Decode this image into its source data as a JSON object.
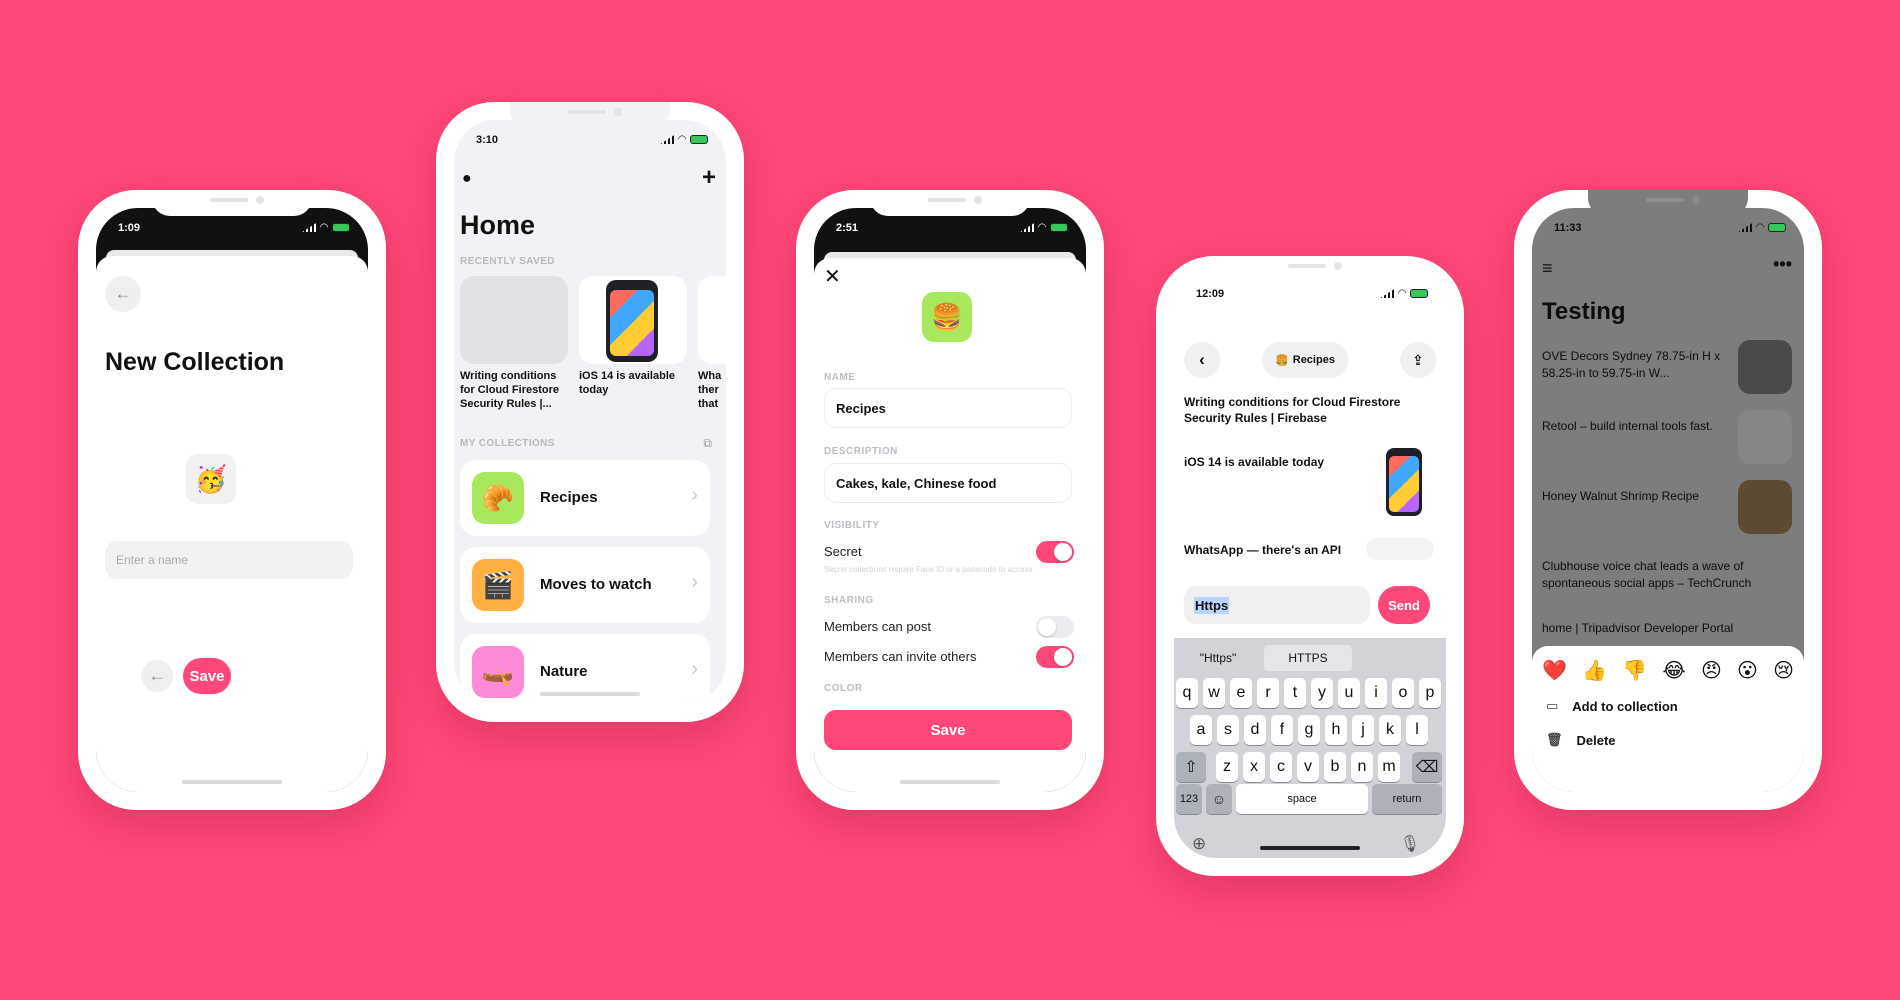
{
  "colors": {
    "accent": "#ff4778",
    "background": "#ff4778"
  },
  "phone1": {
    "time": "1:09",
    "title": "New Collection",
    "emoji": "🥳",
    "name_placeholder": "Enter a name",
    "save_label": "Save"
  },
  "phone2": {
    "time": "3:10",
    "title": "Home",
    "recently_saved_label": "RECENTLY SAVED",
    "recent": [
      {
        "text": "Writing conditions for Cloud Firestore Security Rules  |..."
      },
      {
        "text": "iOS 14 is available today"
      },
      {
        "text": "Wha ther that"
      }
    ],
    "my_collections_label": "MY COLLECTIONS",
    "collections": [
      {
        "emoji": "🥐",
        "label": "Recipes",
        "color": "#a8e85c"
      },
      {
        "emoji": "🎬",
        "label": "Moves to watch",
        "color": "#ffb040"
      },
      {
        "emoji": "🛶",
        "label": "Nature",
        "color": "#ff8ad8"
      }
    ]
  },
  "phone3": {
    "time": "2:51",
    "emoji": "🍔",
    "name_label": "NAME",
    "name_value": "Recipes",
    "description_label": "DESCRIPTION",
    "description_value": "Cakes, kale, Chinese food",
    "visibility_label": "VISIBILITY",
    "secret_label": "Secret",
    "secret_on": true,
    "secret_note": "Secret collections require Face ID or a passcode to access",
    "sharing_label": "SHARING",
    "members_post_label": "Members can post",
    "members_post_on": false,
    "members_invite_label": "Members can invite others",
    "members_invite_on": true,
    "color_label": "COLOR",
    "save_label": "Save"
  },
  "phone4": {
    "time": "12:09",
    "collection_pill": "Recipes",
    "collection_emoji": "🍔",
    "links": [
      {
        "text": "Writing conditions for Cloud Firestore Security Rules  |  Firebase"
      },
      {
        "text": "iOS 14 is available today"
      },
      {
        "text": "WhatsApp — there's an API"
      }
    ],
    "input_value": "Https",
    "send_label": "Send",
    "suggestions": [
      "\"Https\"",
      "HTTPS"
    ],
    "keys_row1": [
      "q",
      "w",
      "e",
      "r",
      "t",
      "y",
      "u",
      "i",
      "o",
      "p"
    ],
    "keys_row2": [
      "a",
      "s",
      "d",
      "f",
      "g",
      "h",
      "j",
      "k",
      "l"
    ],
    "keys_row3": [
      "z",
      "x",
      "c",
      "v",
      "b",
      "n",
      "m"
    ],
    "key_123": "123",
    "key_space": "space",
    "key_return": "return"
  },
  "phone5": {
    "time": "11:33",
    "title": "Testing",
    "items": [
      {
        "text": "OVE Decors Sydney 78.75-in H x 58.25-in to 59.75-in W..."
      },
      {
        "text": "Retool – build internal tools fast."
      },
      {
        "text": "Honey Walnut Shrimp Recipe"
      },
      {
        "text": "Clubhouse voice chat leads a wave of spontaneous social apps – TechCrunch"
      },
      {
        "text": "home | Tripadvisor Developer Portal"
      }
    ],
    "reactions": [
      "❤️",
      "👍",
      "👎",
      "😂",
      "😠",
      "😮",
      "😢"
    ],
    "add_to_collection": "Add to collection",
    "delete": "Delete"
  }
}
